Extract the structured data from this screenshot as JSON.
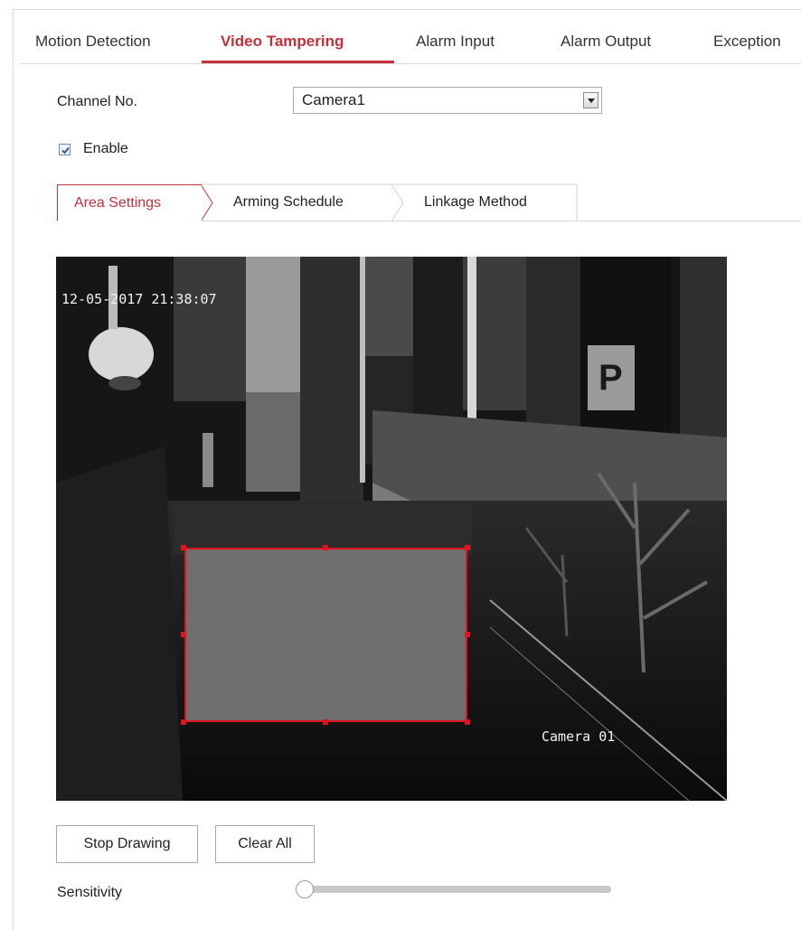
{
  "tabs": [
    {
      "label": "Motion Detection",
      "active": false
    },
    {
      "label": "Video Tampering",
      "active": true
    },
    {
      "label": "Alarm Input",
      "active": false
    },
    {
      "label": "Alarm Output",
      "active": false
    },
    {
      "label": "Exception",
      "active": false
    }
  ],
  "channel": {
    "label": "Channel No.",
    "value": "Camera1"
  },
  "enable": {
    "label": "Enable",
    "checked": true
  },
  "sub_tabs": [
    {
      "label": "Area Settings",
      "active": true
    },
    {
      "label": "Arming Schedule",
      "active": false
    },
    {
      "label": "Linkage Method",
      "active": false
    }
  ],
  "video": {
    "timestamp": "12-05-2017 21:38:07",
    "camera_name": "Camera 01",
    "sign_letter": "P"
  },
  "buttons": {
    "stop_drawing": "Stop Drawing",
    "clear_all": "Clear All"
  },
  "sensitivity": {
    "label": "Sensitivity",
    "value": 0
  },
  "colors": {
    "accent": "#c2313a",
    "region_fill": "#6f6f6f",
    "region_border": "#e0141e"
  }
}
